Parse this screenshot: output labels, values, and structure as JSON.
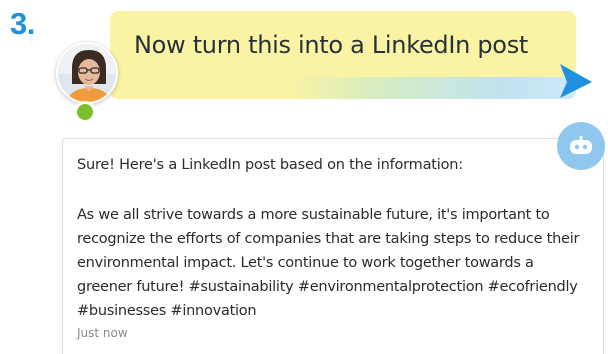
{
  "step": {
    "number": "3."
  },
  "prompt": {
    "text": "Now turn this into a LinkedIn post"
  },
  "response": {
    "intro": "Sure! Here's a LinkedIn post based on the information:",
    "body": "As we all strive towards a more sustainable future, it's important to recognize the efforts of companies that are taking steps to reduce their environmental impact. Let's continue to work together towards a greener future! #sustainability #environmentalprotection #ecofriendly #businesses #innovation",
    "timestamp": "Just now"
  },
  "user": {
    "status": "online"
  },
  "icons": {
    "avatar": "user-avatar",
    "status": "online-status-dot",
    "send": "send-arrow-icon",
    "bot": "bot-icon"
  },
  "colors": {
    "step": "#1f8fe0",
    "prompt_bg": "#faf3a4",
    "send_arrow": "#1f8fe0",
    "bot_bg": "#8fc7ee",
    "online": "#79c12c"
  }
}
